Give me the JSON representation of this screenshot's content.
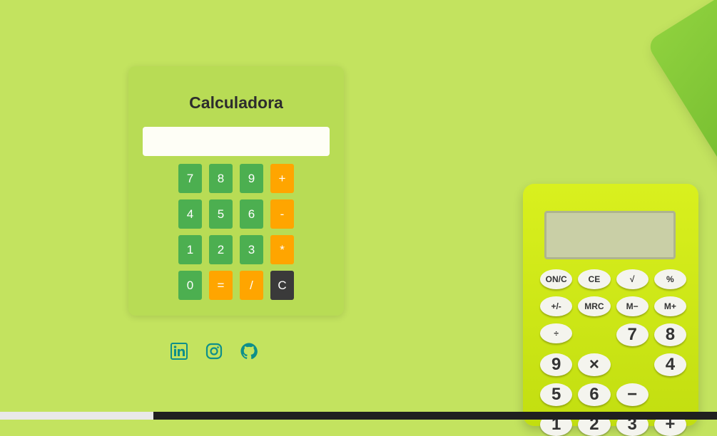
{
  "calculator": {
    "title": "Calculadora",
    "display_value": "",
    "rows": [
      [
        {
          "label": "7",
          "kind": "num"
        },
        {
          "label": "8",
          "kind": "num"
        },
        {
          "label": "9",
          "kind": "num"
        },
        {
          "label": "+",
          "kind": "op"
        }
      ],
      [
        {
          "label": "4",
          "kind": "num"
        },
        {
          "label": "5",
          "kind": "num"
        },
        {
          "label": "6",
          "kind": "num"
        },
        {
          "label": "-",
          "kind": "op"
        }
      ],
      [
        {
          "label": "1",
          "kind": "num"
        },
        {
          "label": "2",
          "kind": "num"
        },
        {
          "label": "3",
          "kind": "num"
        },
        {
          "label": "*",
          "kind": "op"
        }
      ],
      [
        {
          "label": "0",
          "kind": "num"
        },
        {
          "label": "=",
          "kind": "op"
        },
        {
          "label": "/",
          "kind": "op"
        },
        {
          "label": "C",
          "kind": "clr"
        }
      ]
    ]
  },
  "social": [
    {
      "icon": "linkedin-icon"
    },
    {
      "icon": "instagram-icon"
    },
    {
      "icon": "github-icon"
    }
  ],
  "colors": {
    "background": "#c3e35f",
    "card": "#b8dc55",
    "number_button": "#4caf50",
    "operator_button": "#ffa500",
    "clear_button": "#3a3a3a",
    "social_icon": "#0e8f8a"
  },
  "background_calculator": {
    "keys": [
      "ON/C",
      "CE",
      "√",
      "%",
      "+/-",
      "MRC",
      "M−",
      "M+",
      "÷",
      "",
      "7",
      "8",
      "9",
      "×",
      "",
      "4",
      "5",
      "6",
      "−",
      "",
      "1",
      "2",
      "3",
      "+"
    ]
  }
}
